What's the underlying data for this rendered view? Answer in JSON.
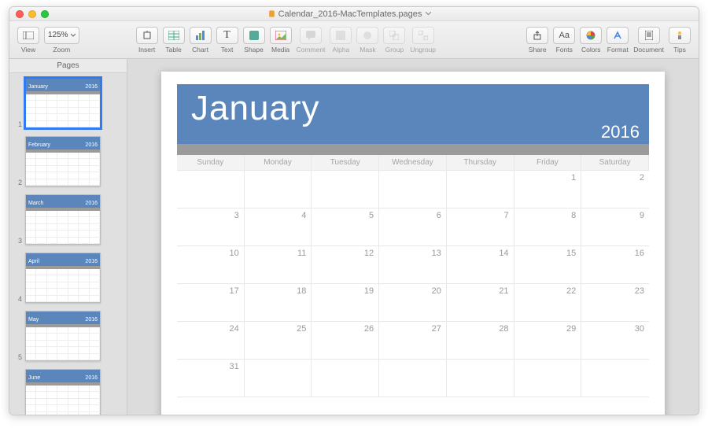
{
  "window": {
    "filename": "Calendar_2016-MacTemplates.pages"
  },
  "toolbar": {
    "view_label": "View",
    "zoom_label": "Zoom",
    "zoom_value": "125%",
    "insert_label": "Insert",
    "table_label": "Table",
    "chart_label": "Chart",
    "text_label": "Text",
    "shape_label": "Shape",
    "media_label": "Media",
    "comment_label": "Comment",
    "alpha_label": "Alpha",
    "mask_label": "Mask",
    "group_label": "Group",
    "ungroup_label": "Ungroup",
    "share_label": "Share",
    "fonts_label": "Fonts",
    "colors_label": "Colors",
    "format_label": "Format",
    "document_label": "Document",
    "tips_label": "Tips"
  },
  "sidebar": {
    "header": "Pages",
    "thumbs": [
      {
        "num": "1",
        "month": "January",
        "year": "2016",
        "selected": true
      },
      {
        "num": "2",
        "month": "February",
        "year": "2016",
        "selected": false
      },
      {
        "num": "3",
        "month": "March",
        "year": "2016",
        "selected": false
      },
      {
        "num": "4",
        "month": "April",
        "year": "2016",
        "selected": false
      },
      {
        "num": "5",
        "month": "May",
        "year": "2016",
        "selected": false
      },
      {
        "num": "",
        "month": "June",
        "year": "2016",
        "selected": false
      }
    ]
  },
  "calendar": {
    "month": "January",
    "year": "2016",
    "days": [
      "Sunday",
      "Monday",
      "Tuesday",
      "Wednesday",
      "Thursday",
      "Friday",
      "Saturday"
    ],
    "rows": [
      [
        "",
        "",
        "",
        "",
        "",
        "1",
        "2"
      ],
      [
        "3",
        "4",
        "5",
        "6",
        "7",
        "8",
        "9"
      ],
      [
        "10",
        "11",
        "12",
        "13",
        "14",
        "15",
        "16"
      ],
      [
        "17",
        "18",
        "19",
        "20",
        "21",
        "22",
        "23"
      ],
      [
        "24",
        "25",
        "26",
        "27",
        "28",
        "29",
        "30"
      ],
      [
        "31",
        "",
        "",
        "",
        "",
        "",
        ""
      ]
    ]
  },
  "colors": {
    "banner_bg": "#5a86bb",
    "graybar": "#9b9b9b",
    "selection": "#2f7bf5"
  }
}
